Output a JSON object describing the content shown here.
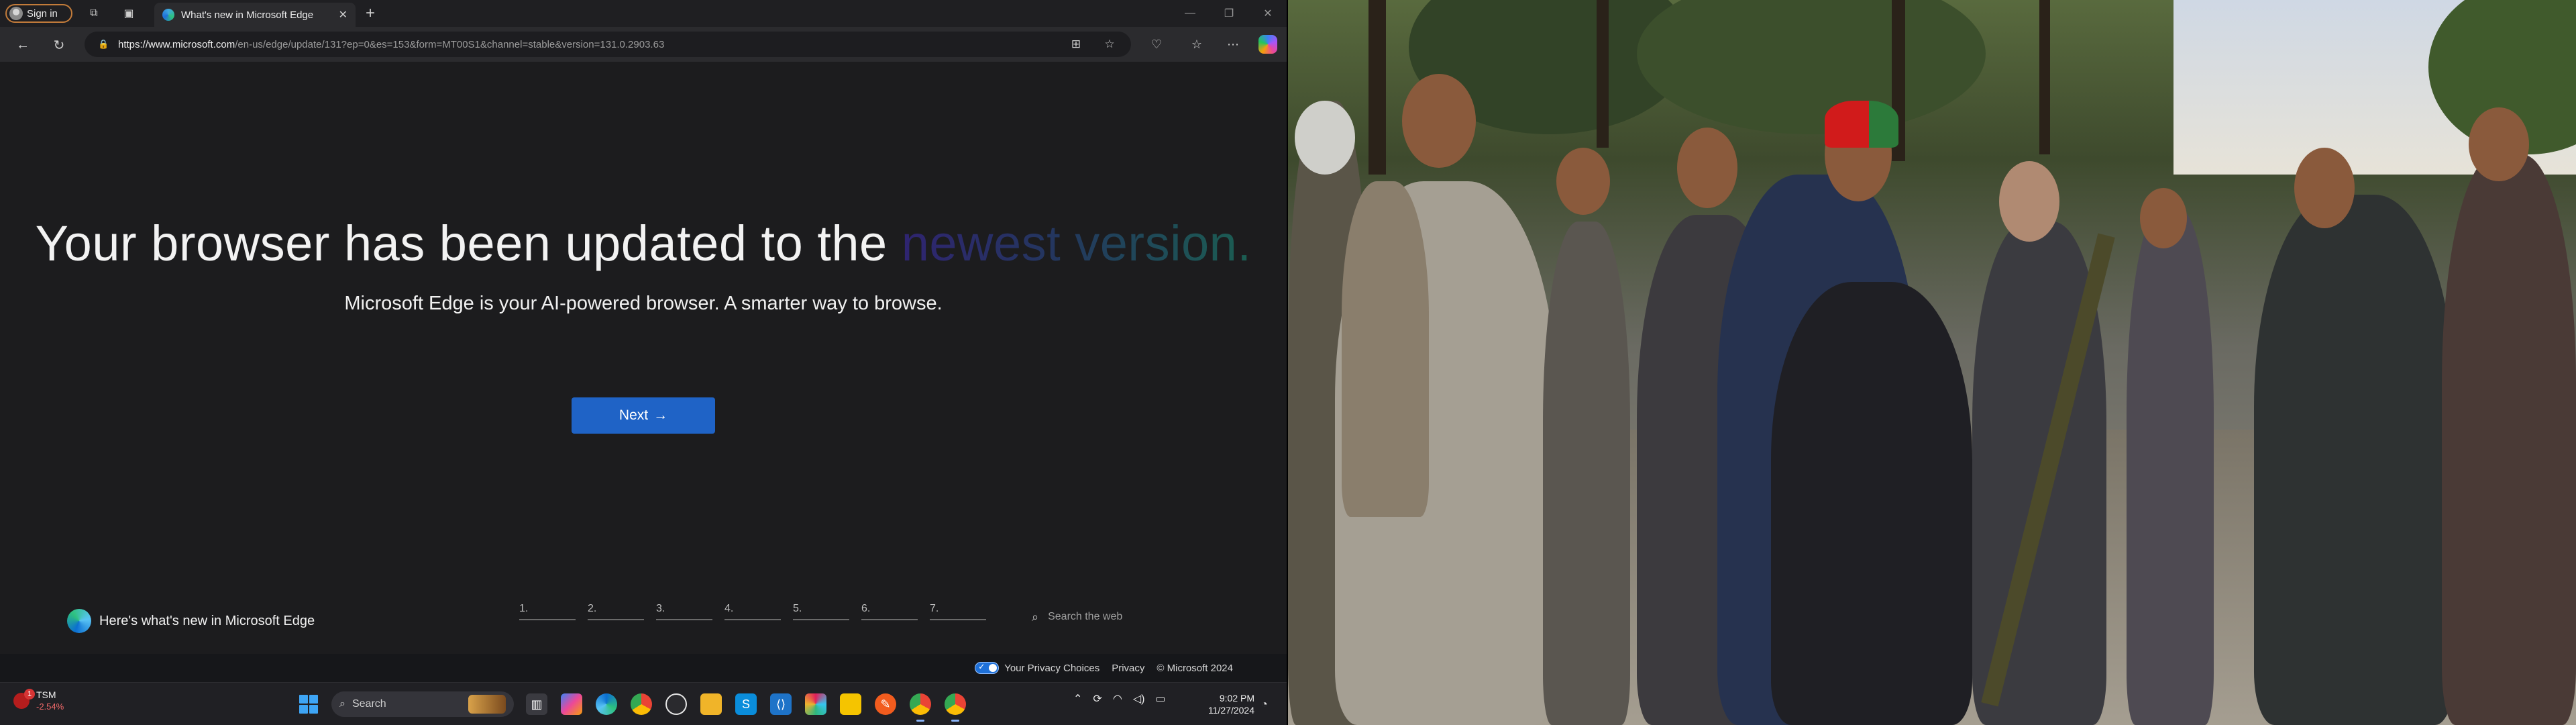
{
  "browser": {
    "profile_label": "Sign in",
    "tab_title": "What's new in Microsoft Edge",
    "url_host": "https://www.microsoft.com",
    "url_path": "/en-us/edge/update/131?ep=0&es=153&form=MT00S1&channel=stable&version=131.0.2903.63"
  },
  "page": {
    "headline_main": "Your browser has been updated to the ",
    "headline_accent": "newest version.",
    "subhead": "Microsoft Edge is your AI-powered browser. A smarter way to browse.",
    "next_label": "Next",
    "next_arrow": "→",
    "footer_brand": "Here's what's new in Microsoft Edge",
    "steps": [
      "1.",
      "2.",
      "3.",
      "4.",
      "5.",
      "6.",
      "7."
    ],
    "search_placeholder": "Search the web",
    "privacy_choices": "Your Privacy Choices",
    "privacy": "Privacy",
    "copyright": "© Microsoft 2024"
  },
  "taskbar": {
    "widget": {
      "symbol": "TSM",
      "change": "-2.54%",
      "badge": "1"
    },
    "search_label": "Search",
    "time": "9:02 PM",
    "date": "11/27/2024",
    "apps": [
      "file-explorer-icon",
      "copilot-icon",
      "edge-icon",
      "chrome-icon",
      "epic-icon",
      "files-icon",
      "skype-icon",
      "vscode-icon",
      "slack-icon",
      "notes-icon",
      "app-icon",
      "chrome-active-icon",
      "chrome-profile-icon"
    ]
  },
  "colors": {
    "accent_blue": "#1f63c6",
    "page_bg": "#1c1c1e",
    "toolbar_bg": "#2b2b2e",
    "taskbar_bg": "#202024"
  }
}
